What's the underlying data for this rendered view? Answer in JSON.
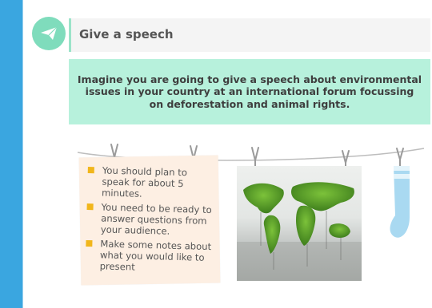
{
  "header": {
    "title": "Give a speech",
    "badge_icon": "paper-plane-icon"
  },
  "prompt": {
    "text": "Imagine you are going to give a speech about environmental issues in your country at an international forum focussing on deforestation and animal rights."
  },
  "notes": {
    "items": [
      "You should plan to speak for about 5 minutes.",
      "You need to be ready to answer questions from your audience.",
      "Make some notes about what you would like to present"
    ]
  },
  "photo": {
    "subject": "world-map-made-of-trees"
  },
  "colors": {
    "side_bar": "#3aa6e0",
    "accent_green": "#7fdcbc",
    "prompt_bg": "#b7f1dc",
    "note_bg": "#fdefe3",
    "bullet": "#f1b61b",
    "sock": "#a9d9f1"
  }
}
